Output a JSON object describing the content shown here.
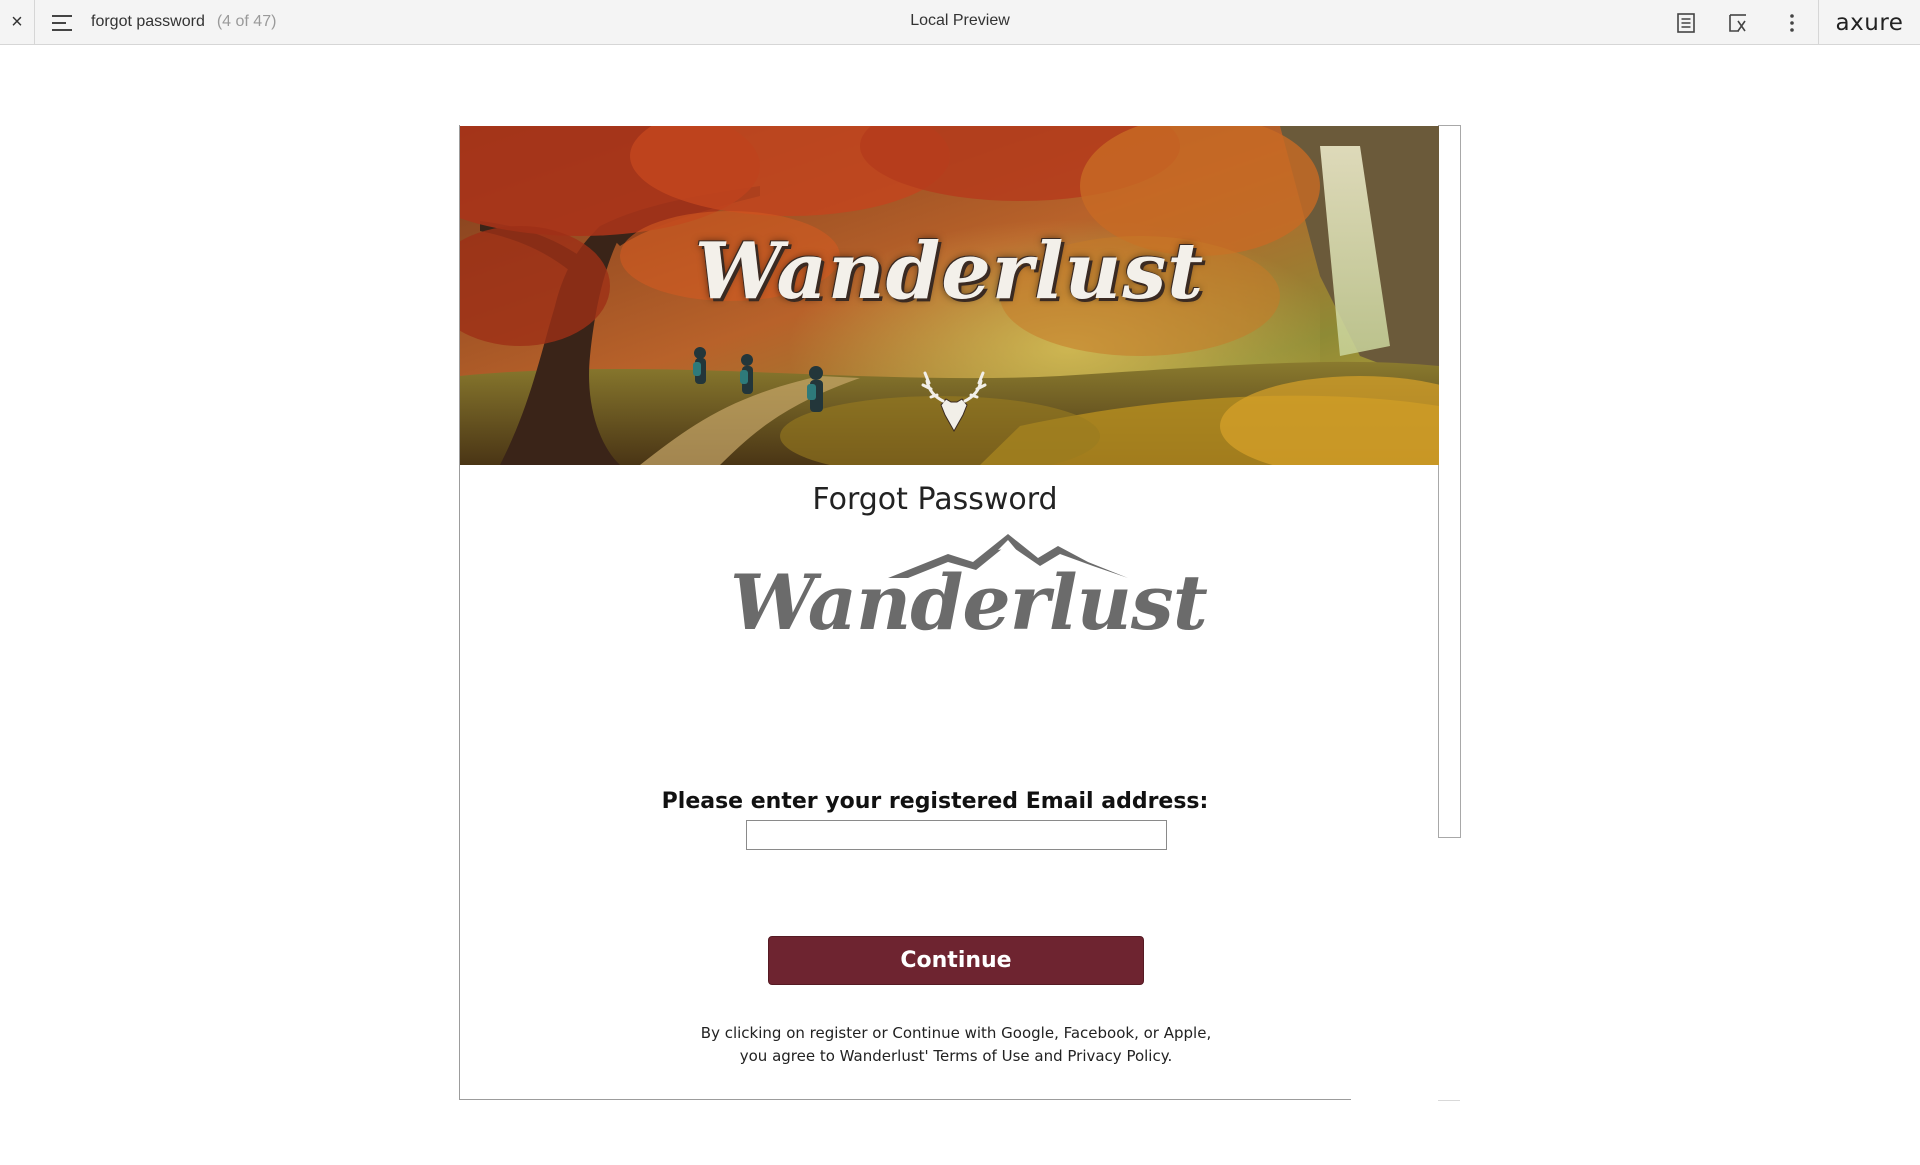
{
  "toolbar": {
    "close_icon": "×",
    "page_name": "forgot password",
    "page_count": "(4 of 47)",
    "center_title": "Local Preview",
    "brand": "axure"
  },
  "hero": {
    "title": "Wanderlust"
  },
  "content": {
    "heading": "Forgot Password",
    "logo_text": "Wanderlust",
    "email_label": "Please enter your registered Email address:",
    "email_value": "",
    "continue_label": "Continue",
    "legal_line1": "By clicking on register or Continue with Google, Facebook, or Apple,",
    "legal_line2": "you agree to Wanderlust' Terms of Use and Privacy Policy."
  },
  "colors": {
    "continue_bg": "#6e2430",
    "toolbar_bg": "#f4f4f4",
    "logo_gray": "#6b6b6b"
  },
  "icons": [
    "close-icon",
    "hamburger-menu-icon",
    "notes-icon",
    "variable-icon",
    "more-vertical-icon",
    "stag-icon",
    "mountain-icon"
  ]
}
